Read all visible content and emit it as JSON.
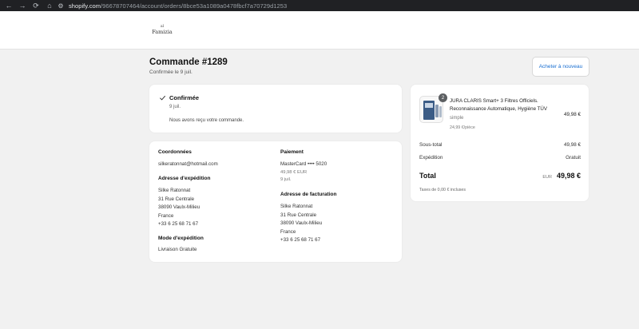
{
  "browser": {
    "url_domain": "shopify.com",
    "url_path": "/96678707464/account/orders/8bce53a1089a0478fbcf7a70729d1253",
    "icons": [
      "back-arrow-icon",
      "forward-arrow-icon",
      "reload-icon",
      "home-icon",
      "site-settings-icon"
    ]
  },
  "store": {
    "logo_mark": "al",
    "logo_text": "Famizia"
  },
  "order": {
    "title": "Commande #1289",
    "confirmed_on": "Confirmée le 9 juil.",
    "buy_again_label": "Acheter à nouveau"
  },
  "status": {
    "title": "Confirmée",
    "date": "9 juil.",
    "message": "Nous avons reçu votre commande."
  },
  "details": {
    "contact_label": "Coordonnées",
    "contact_email": "silkeratonnat@hotmail.com",
    "shipping_address_label": "Adresse d'expédition",
    "shipping_address": [
      "Silke Ratonnat",
      "31 Rue Centrale",
      "38090 Vaulx-Milieu",
      "France",
      "+33 6 25 68 71 67"
    ],
    "shipping_method_label": "Mode d'expédition",
    "shipping_method": "Livraison Gratuite",
    "payment_label": "Paiement",
    "payment_card": "MasterCard •••• 5020",
    "payment_amount": "49,98 € EUR",
    "payment_date": "9 juil.",
    "billing_address_label": "Adresse de facturation",
    "billing_address": [
      "Silke Ratonnat",
      "31 Rue Centrale",
      "38090 Vaulx-Milieu",
      "France",
      "+33 6 25 68 71 67"
    ]
  },
  "summary": {
    "quantity": "2",
    "product_name": "JURA CLARIS Smart+ 3 Filtres Officiels. Reconnaissance Automatique, Hygiène TÜV",
    "variant": "simple",
    "unit_price": "24,99 €/pièce",
    "line_price": "49,98 €",
    "subtotal_label": "Sous-total",
    "subtotal": "49,98 €",
    "shipping_label": "Expédition",
    "shipping": "Gratuit",
    "total_label": "Total",
    "currency": "EUR",
    "total": "49,98 €",
    "tax_note": "Taxes de 0,00 € incluses"
  },
  "colors": {
    "accent": "#1a6fd1",
    "page_bg": "#f1f1f1",
    "browser_bar": "#202124"
  }
}
